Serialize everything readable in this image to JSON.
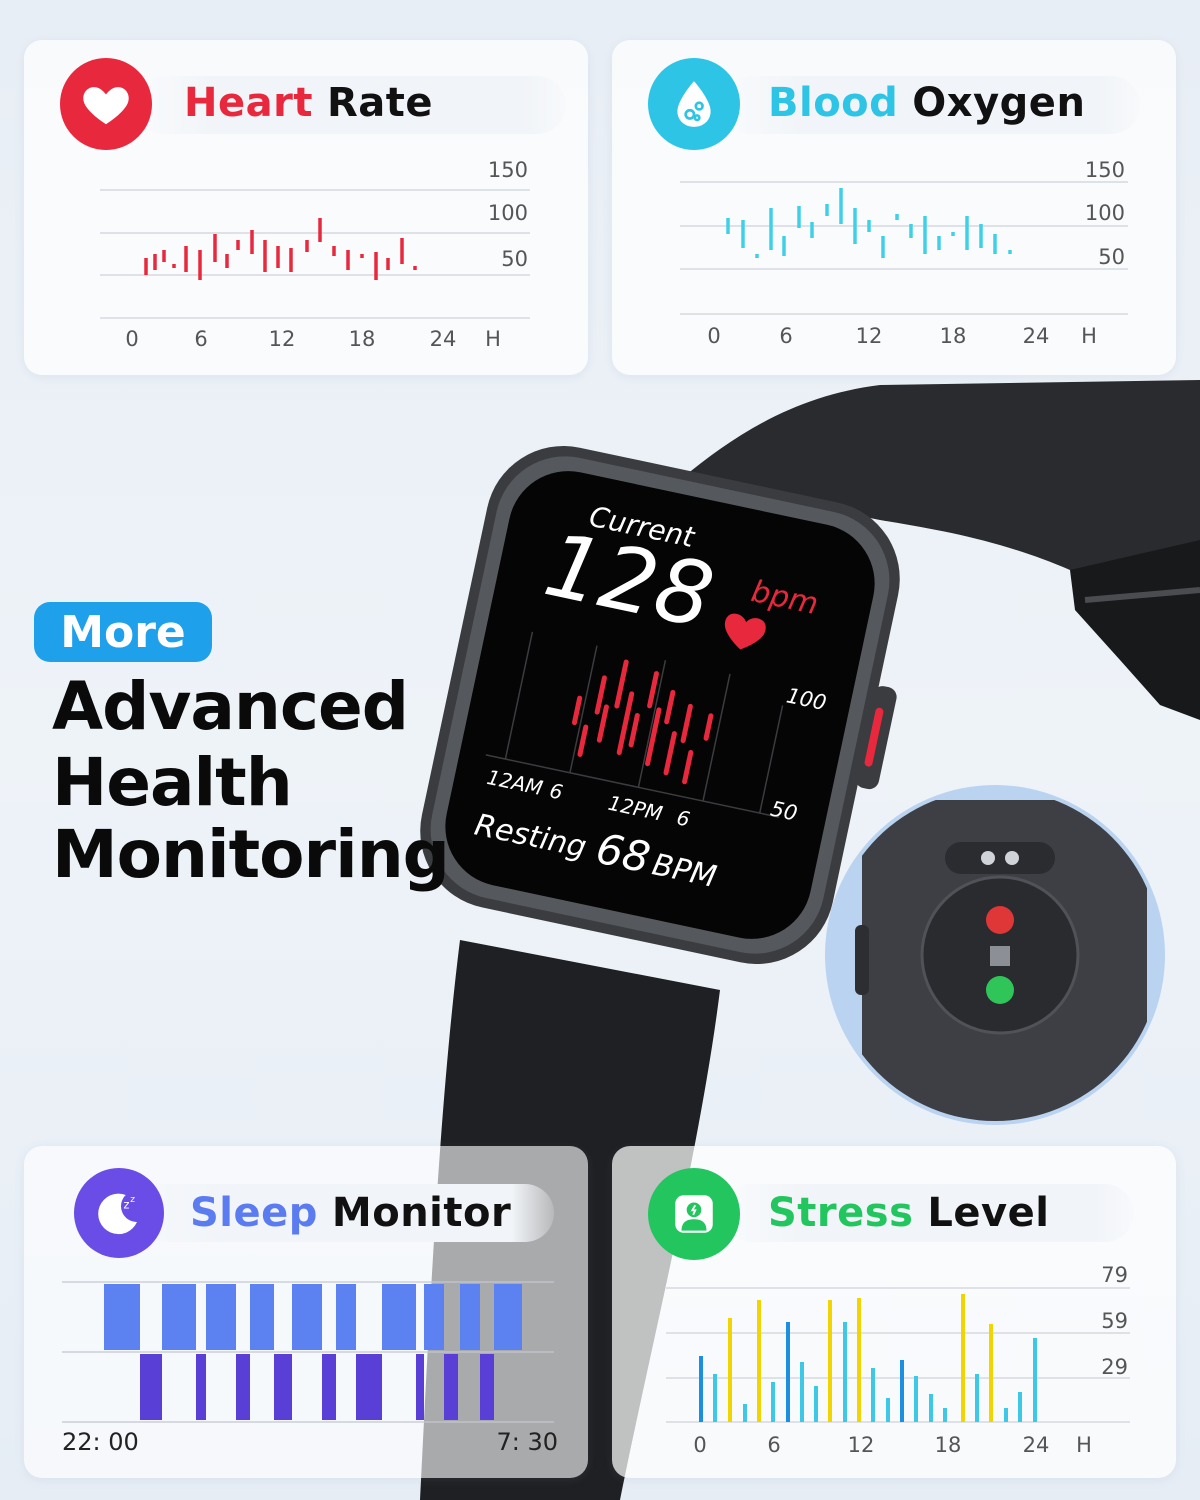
{
  "heart_rate": {
    "title_colored": "Heart",
    "title_rest": "Rate",
    "accent": "#e8283d",
    "icon": "heart-icon",
    "y_ticks": [
      "150",
      "100",
      "50"
    ],
    "x_ticks": [
      "0",
      "6",
      "12",
      "18",
      "24",
      "H"
    ]
  },
  "blood_oxygen": {
    "title_colored": "Blood",
    "title_rest": "Oxygen",
    "accent": "#2ec4e6",
    "icon": "water-drop-icon",
    "y_ticks": [
      "150",
      "100",
      "50"
    ],
    "x_ticks": [
      "0",
      "6",
      "12",
      "18",
      "24",
      "H"
    ]
  },
  "headline": {
    "badge": "More",
    "line1": "Advanced",
    "line2": "Health",
    "line3": "Monitoring"
  },
  "watch": {
    "label_current": "Current",
    "bpm_value": "128",
    "bpm_unit": "bpm",
    "y_top": "100",
    "y_bottom": "50",
    "x_labels": [
      "12AM",
      "6",
      "12PM",
      "6"
    ],
    "resting_label": "Resting",
    "resting_value": "68",
    "resting_unit": "BPM"
  },
  "sleep_monitor": {
    "title_colored": "Sleep",
    "title_rest": "Monitor",
    "accent": "#5b7cf0",
    "icon": "moon-sleep-icon",
    "start_time": "22: 00",
    "end_time": "7: 30"
  },
  "stress_level": {
    "title_colored": "Stress",
    "title_rest": "Level",
    "accent": "#22c55e",
    "icon": "person-stress-icon",
    "y_ticks": [
      "79",
      "59",
      "29"
    ],
    "x_ticks": [
      "0",
      "6",
      "12",
      "18",
      "24",
      "H"
    ]
  }
}
